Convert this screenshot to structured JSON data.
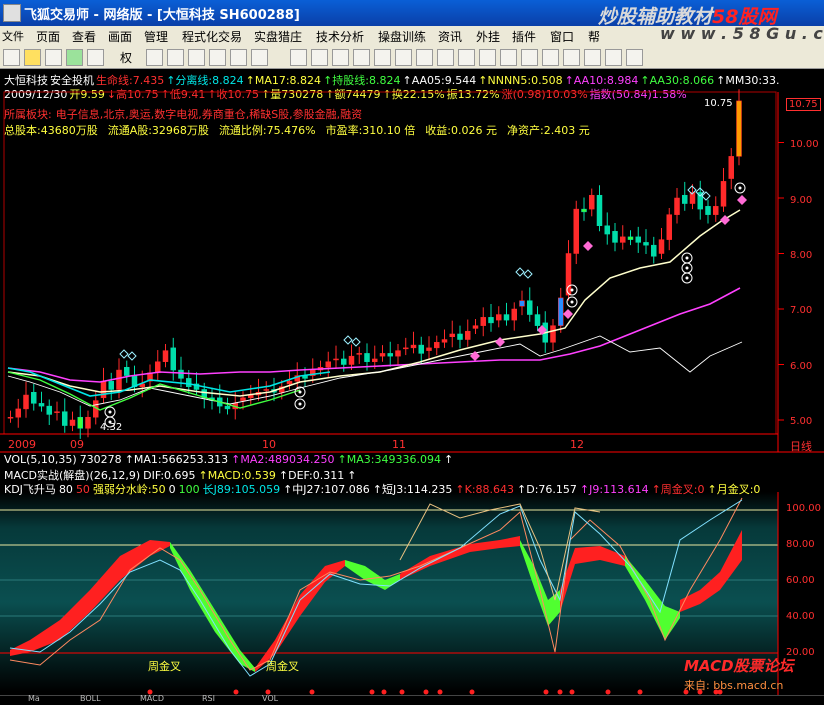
{
  "window": {
    "title": "飞狐交易师 - 网络版 - [大恒科技 SH600288]",
    "watermark_prefix": "炒股辅助教材",
    "watermark_brand": "58股网",
    "watermark_url": "w w w . 5 8 G u . c o m"
  },
  "menu": [
    "文件",
    "页面",
    "查看",
    "画面",
    "管理",
    "程式化交易",
    "实盘猎庄",
    "技术分析",
    "操盘训练",
    "资讯",
    "外挂",
    "插件",
    "窗口",
    "帮"
  ],
  "toolbar": {
    "quanxian": "权"
  },
  "stock_info": {
    "line1": [
      {
        "text": "大恒科技",
        "color": "#ffffff"
      },
      {
        "text": "安全投机",
        "color": "#ffffff"
      },
      {
        "text": "生命线:7.435",
        "color": "#ff3030"
      },
      {
        "text": "↑分离线:8.824",
        "color": "#00e5e5"
      },
      {
        "text": "↑MA17:8.824",
        "color": "#ffff40"
      },
      {
        "text": "↑持股线:8.824",
        "color": "#40ff40"
      },
      {
        "text": "↑AA05:9.544",
        "color": "#ffffff"
      },
      {
        "text": "↑NNNN5:0.508",
        "color": "#ffff40"
      },
      {
        "text": "↑AA10:8.984",
        "color": "#ff40ff"
      },
      {
        "text": "↑AA30:8.066",
        "color": "#40ff40"
      },
      {
        "text": "↑MM30:33.",
        "color": "#ffffff"
      }
    ],
    "line2": [
      {
        "text": "2009/12/30",
        "color": "#ffffff"
      },
      {
        "text": "开9.59",
        "color": "#ffff40"
      },
      {
        "text": "↓高10.75",
        "color": "#ff3030"
      },
      {
        "text": "↑低9.41",
        "color": "#ff3030"
      },
      {
        "text": "↑收10.75",
        "color": "#ff3030"
      },
      {
        "text": "↑量730278",
        "color": "#ffff40"
      },
      {
        "text": "↑额74479",
        "color": "#ffff40"
      },
      {
        "text": "↑换22.15%",
        "color": "#ffff40"
      },
      {
        "text": "振13.72%",
        "color": "#ffff40"
      },
      {
        "text": "涨(0.98)10.03%",
        "color": "#ff3030"
      },
      {
        "text": "指数(50.84)1.58%",
        "color": "#ff40ff"
      }
    ],
    "line3": [
      {
        "text": "所属板块:",
        "color": "#ff3030"
      },
      {
        "text": "电子信息,北京,奥运,数字电视,券商重仓,稀缺S股,参股金融,融资",
        "color": "#ff3030"
      }
    ],
    "line4": [
      {
        "text": "总股本:43680万股",
        "color": "#ffff40"
      },
      {
        "text": "流通A股:32968万股",
        "color": "#ffff40"
      },
      {
        "text": "流通比例:75.476%",
        "color": "#ffff40"
      },
      {
        "text": "市盈率:310.10 倍",
        "color": "#ffff40"
      },
      {
        "text": "收益:0.026 元",
        "color": "#ffff40"
      },
      {
        "text": "净资产:2.403 元",
        "color": "#ffff40"
      }
    ]
  },
  "price_axis": {
    "labels": [
      "10.75",
      "10.00",
      "9.00",
      "8.00",
      "7.00",
      "6.00",
      "5.00"
    ],
    "current_price": "10.75",
    "top_label": "10.75",
    "low_label": "4.32"
  },
  "time_axis": {
    "labels": [
      "2009",
      "09",
      "10",
      "11",
      "12"
    ],
    "tail": "日线"
  },
  "vol_line": [
    {
      "text": "VOL(5,10,35)",
      "color": "#ffffff"
    },
    {
      "text": "730278",
      "color": "#ffffff"
    },
    {
      "text": "↑MA1:566253.313",
      "color": "#ffffff"
    },
    {
      "text": "↑MA2:489034.250",
      "color": "#ff40ff"
    },
    {
      "text": "↑MA3:349336.094",
      "color": "#40ff40"
    },
    {
      "text": "↑",
      "color": "#ffffff"
    }
  ],
  "macd_line": [
    {
      "text": "MACD实战(解盘)(26,12,9)",
      "color": "#ffffff"
    },
    {
      "text": "DIF:0.695",
      "color": "#ffffff"
    },
    {
      "text": "↑MACD:0.539",
      "color": "#ffff40"
    },
    {
      "text": "↑DEF:0.311",
      "color": "#ffffff"
    },
    {
      "text": "↑",
      "color": "#ffffff"
    }
  ],
  "kdj_line": [
    {
      "text": "KDJ飞升马",
      "color": "#ffffff"
    },
    {
      "text": "80",
      "color": "#ffffff"
    },
    {
      "text": "50",
      "color": "#ff3030"
    },
    {
      "text": "强弱分水岭:50",
      "color": "#ffff40"
    },
    {
      "text": "0",
      "color": "#ffffff"
    },
    {
      "text": "100",
      "color": "#40ff40"
    },
    {
      "text": "长J89:105.059",
      "color": "#00e5e5"
    },
    {
      "text": "↑中J27:107.086",
      "color": "#ffffff"
    },
    {
      "text": "↑短J3:114.235",
      "color": "#ffffff"
    },
    {
      "text": "↑K:88.643",
      "color": "#ff3030"
    },
    {
      "text": "↑D:76.157",
      "color": "#ffffff"
    },
    {
      "text": "↑J9:113.614",
      "color": "#ff40ff"
    },
    {
      "text": "↑周金叉:0",
      "color": "#ff3030"
    },
    {
      "text": "↑月金叉:0",
      "color": "#ffff40"
    }
  ],
  "kdj_axis": [
    "100.00",
    "80.00",
    "60.00",
    "40.00",
    "20.00"
  ],
  "signals": [
    "周金叉",
    "周金叉"
  ],
  "bottom_tabs": [
    "Ma",
    "BOLL",
    "MACD",
    "RSI",
    "VOL"
  ],
  "macd_watermark": {
    "title": "MACD股票论坛",
    "sub": "来自: bbs.macd.cn"
  },
  "colors": {
    "up": "#ff2a2a",
    "down": "#00ddaa",
    "bg": "#000000",
    "axis": "#ff0000"
  }
}
